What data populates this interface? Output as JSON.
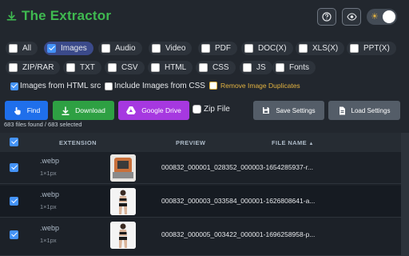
{
  "app": {
    "title": "The Extractor"
  },
  "filters": {
    "row1": [
      {
        "label": "All",
        "checked": false
      },
      {
        "label": "Images",
        "checked": true
      },
      {
        "label": "Audio",
        "checked": false
      },
      {
        "label": "Video",
        "checked": false
      },
      {
        "label": "PDF",
        "checked": false
      },
      {
        "label": "DOC(X)",
        "checked": false
      },
      {
        "label": "XLS(X)",
        "checked": false
      },
      {
        "label": "PPT(X)",
        "checked": false
      }
    ],
    "row2": [
      {
        "label": "ZIP/RAR",
        "checked": false
      },
      {
        "label": "TXT",
        "checked": false
      },
      {
        "label": "CSV",
        "checked": false
      },
      {
        "label": "HTML",
        "checked": false
      },
      {
        "label": "CSS",
        "checked": false
      },
      {
        "label": "JS",
        "checked": false
      },
      {
        "label": "Fonts",
        "checked": false
      }
    ]
  },
  "options": {
    "images_from_html": "Images from HTML src",
    "include_css": "Include Images from CSS",
    "remove_duplicates": "Remove Image Duplicates"
  },
  "actions": {
    "find": "Find",
    "download": "Download",
    "google_drive": "Google Drive",
    "zip_file": "Zip File",
    "save_settings": "Save Settings",
    "load_settings": "Load Settings"
  },
  "status": {
    "found_text": "683 files found / 683 selected"
  },
  "table": {
    "headers": {
      "extension": "EXTENSION",
      "preview": "PREVIEW",
      "file_name": "FILE NAME",
      "sort_indicator": "▲"
    },
    "rows": [
      {
        "ext": ".webp",
        "dim": "1×1px",
        "name": "000832_000001_028352_000003-1654285937-r..."
      },
      {
        "ext": ".webp",
        "dim": "1×1px",
        "name": "000832_000003_033584_000001-1626808641-a..."
      },
      {
        "ext": ".webp",
        "dim": "1×1px",
        "name": "000832_000005_003422_000001-1696258958-p..."
      }
    ]
  },
  "colors": {
    "accent": "#3fb950",
    "find": "#1f6feb",
    "download": "#2ea043",
    "drive": "#a638e0",
    "warn": "#e3b341"
  }
}
